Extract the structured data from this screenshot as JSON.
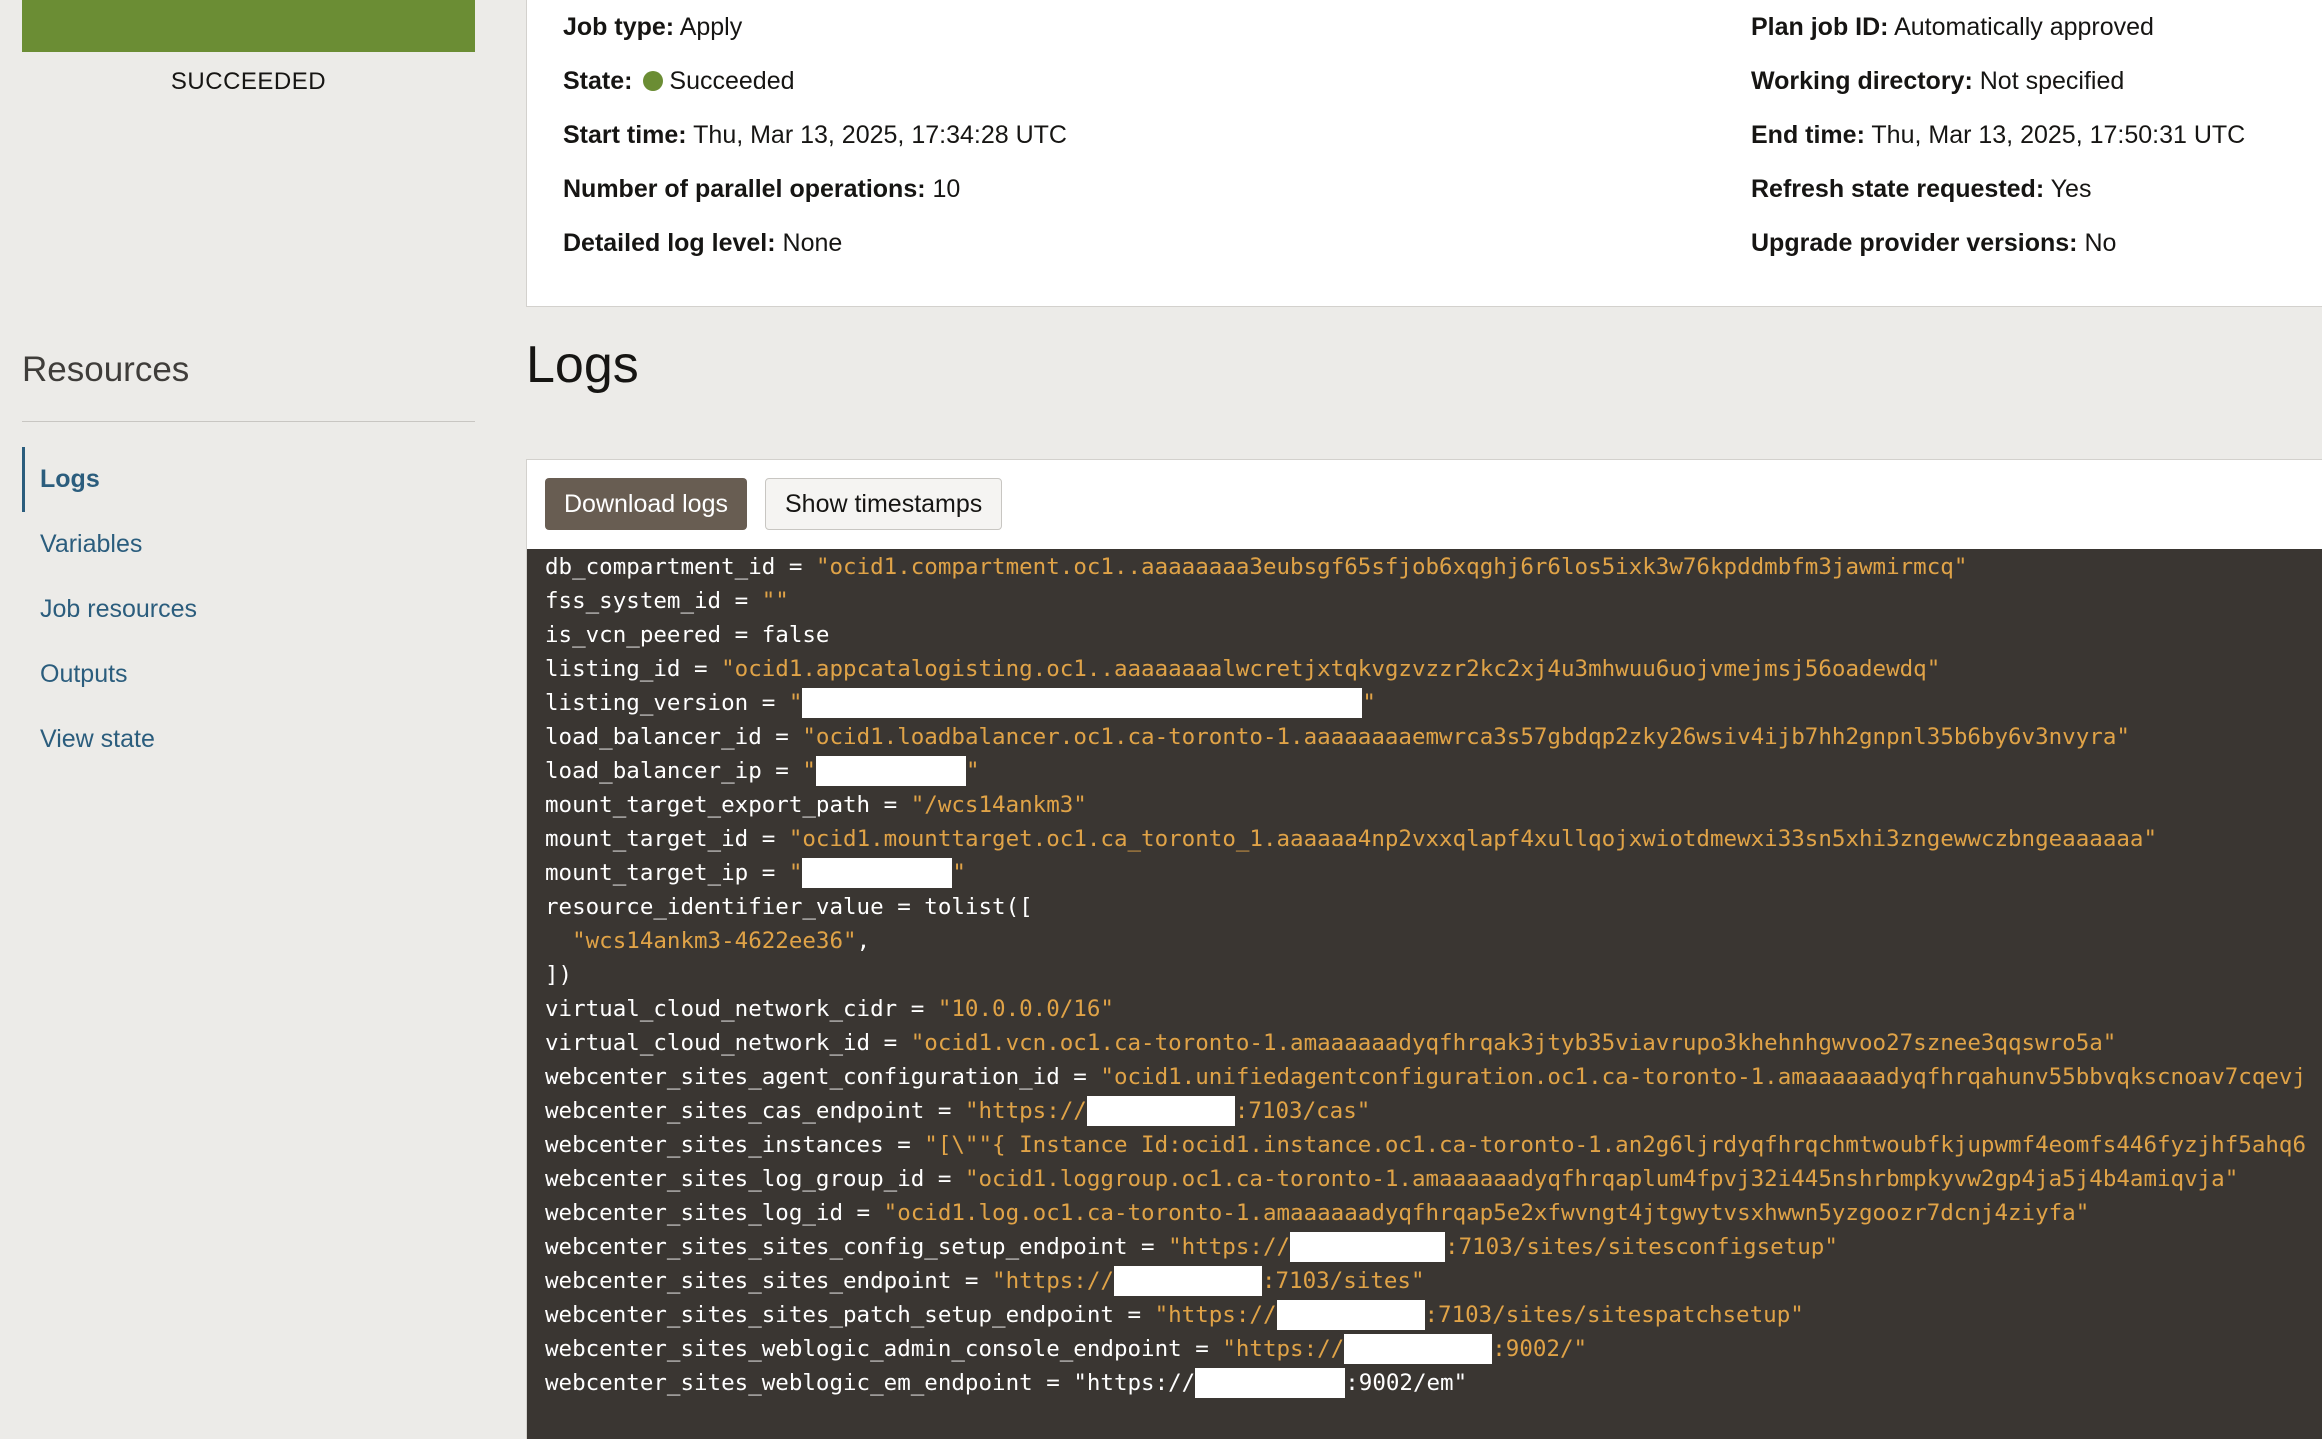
{
  "sidebar": {
    "status": "SUCCEEDED",
    "resources_title": "Resources",
    "items": [
      {
        "label": "Logs",
        "active": true
      },
      {
        "label": "Variables"
      },
      {
        "label": "Job resources"
      },
      {
        "label": "Outputs"
      },
      {
        "label": "View state"
      }
    ]
  },
  "details": {
    "left": [
      {
        "label": "Job type:",
        "value": "Apply"
      },
      {
        "label": "State:",
        "value": "Succeeded"
      },
      {
        "label": "Start time:",
        "value": "Thu, Mar 13, 2025, 17:34:28 UTC"
      },
      {
        "label": "Number of parallel operations:",
        "value": "10"
      },
      {
        "label": "Detailed log level:",
        "value": "None"
      }
    ],
    "right": [
      {
        "label": "Plan job ID:",
        "value": "Automatically approved"
      },
      {
        "label": "Working directory:",
        "value": "Not specified"
      },
      {
        "label": "End time:",
        "value": "Thu, Mar 13, 2025, 17:50:31 UTC"
      },
      {
        "label": "Refresh state requested:",
        "value": "Yes"
      },
      {
        "label": "Upgrade provider versions:",
        "value": "No"
      }
    ]
  },
  "logs": {
    "heading": "Logs",
    "download_label": "Download logs",
    "timestamps_label": "Show timestamps",
    "lines": [
      {
        "key": "db_compartment_id = ",
        "str": "\"ocid1.compartment.oc1..aaaaaaaa3eubsgf65sfjob6xqghj6r6los5ixk3w76kpddmbfm3jawmirmcq\""
      },
      {
        "key": "fss_system_id = ",
        "str": "\"\""
      },
      {
        "key": "is_vcn_peered = false",
        "str": ""
      },
      {
        "key": "listing_id = ",
        "str": "\"ocid1.appcatalogisting.oc1..aaaaaaaalwcretjxtqkvgzvzzr2kc2xj4u3mhwuu6uojvmejmsj56oadewdq\""
      },
      {
        "key": "listing_version = ",
        "str": "\"",
        "redact": 560,
        "after": "\""
      },
      {
        "key": "load_balancer_id = ",
        "str": "\"ocid1.loadbalancer.oc1.ca-toronto-1.aaaaaaaaemwrca3s57gbdqp2zky26wsiv4ijb7hh2gnpnl35b6by6v3nvyra\""
      },
      {
        "key": "load_balancer_ip = ",
        "str": "\"",
        "redact": 150,
        "after": "\""
      },
      {
        "key": "mount_target_export_path = ",
        "str": "\"/wcs14ankm3\""
      },
      {
        "key": "mount_target_id = ",
        "str": "\"ocid1.mounttarget.oc1.ca_toronto_1.aaaaaa4np2vxxqlapf4xullqojxwiotdmewxi33sn5xhi3zngewwczbngeaaaaaa\""
      },
      {
        "key": "mount_target_ip = ",
        "str": "\"",
        "redact": 150,
        "after": "\""
      },
      {
        "key": "resource_identifier_value = tolist([",
        "str": ""
      },
      {
        "key": "  ",
        "str": "\"wcs14ankm3-4622ee36\"",
        "after_plain": ","
      },
      {
        "key": "])",
        "str": ""
      },
      {
        "key": "virtual_cloud_network_cidr = ",
        "str": "\"10.0.0.0/16\""
      },
      {
        "key": "virtual_cloud_network_id = ",
        "str": "\"ocid1.vcn.oc1.ca-toronto-1.amaaaaaadyqfhrqak3jtyb35viavrupo3khehnhgwvoo27sznee3qqswro5a\""
      },
      {
        "key": "webcenter_sites_agent_configuration_id = ",
        "str": "\"ocid1.unifiedagentconfiguration.oc1.ca-toronto-1.amaaaaaadyqfhrqahunv55bbvqkscnoav7cqevj"
      },
      {
        "key": "webcenter_sites_cas_endpoint = ",
        "str": "\"https://",
        "redact": 148,
        "after": ":7103/cas\""
      },
      {
        "key": "webcenter_sites_instances = ",
        "str": "\"[\\\"\"{ Instance Id:ocid1.instance.oc1.ca-toronto-1.an2g6ljrdyqfhrqchmtwoubfkjupwmf4eomfs446fyzjhf5ahq6"
      },
      {
        "key": "webcenter_sites_log_group_id = ",
        "str": "\"ocid1.loggroup.oc1.ca-toronto-1.amaaaaaadyqfhrqaplum4fpvj32i445nshrbmpkyvw2gp4ja5j4b4amiqvja\""
      },
      {
        "key": "webcenter_sites_log_id = ",
        "str": "\"ocid1.log.oc1.ca-toronto-1.amaaaaaadyqfhrqap5e2xfwvngt4jtgwytvsxhwwn5yzgoozr7dcnj4ziyfa\""
      },
      {
        "key": "webcenter_sites_sites_config_setup_endpoint = ",
        "str": "\"https://",
        "redact": 155,
        "after": ":7103/sites/sitesconfigsetup\""
      },
      {
        "key": "webcenter_sites_sites_endpoint = ",
        "str": "\"https://",
        "redact": 148,
        "after": ":7103/sites\""
      },
      {
        "key": "webcenter_sites_sites_patch_setup_endpoint = ",
        "str": "\"https://",
        "redact": 148,
        "after": ":7103/sites/sitespatchsetup\""
      },
      {
        "key": "webcenter_sites_weblogic_admin_console_endpoint = ",
        "str": "\"https://",
        "redact": 148,
        "after": ":9002/\""
      },
      {
        "key": "webcenter_sites_weblogic_em_endpoint = ",
        "str": "",
        "plain_prefix": "\"https://",
        "redact": 150,
        "after_plain": ":9002/em\""
      }
    ]
  },
  "colors": {
    "status_green": "#6b8d34",
    "link": "#2b5d7d",
    "console_bg": "#3a3632",
    "console_string": "#e0a347",
    "download_btn": "#685d52"
  }
}
